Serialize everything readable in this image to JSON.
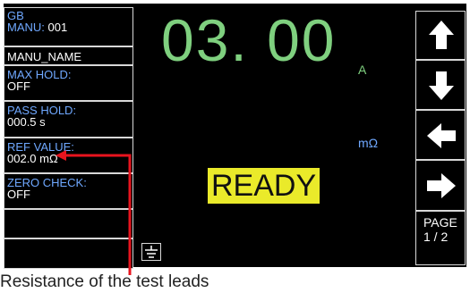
{
  "left_panel": {
    "title": "GB",
    "manu_label": "MANU:",
    "manu_value": "001",
    "manu_name": "MANU_NAME",
    "max_hold_label": "MAX HOLD:",
    "max_hold_value": "OFF",
    "pass_hold_label": "PASS HOLD:",
    "pass_hold_value": "000.5 s",
    "ref_value_label": "REF VALUE:",
    "ref_value_value": "002.0 mΩ",
    "zero_check_label": "ZERO CHECK:",
    "zero_check_value": "OFF"
  },
  "main": {
    "current_reading": "03. 00",
    "current_unit": "A",
    "resistance_unit": "mΩ",
    "status": "READY",
    "ground_icon": "ground-icon"
  },
  "right_panel": {
    "buttons": [
      "arrow-up-icon",
      "arrow-down-icon",
      "arrow-left-icon",
      "arrow-right-icon"
    ],
    "page_label": "PAGE",
    "page_number": "1 / 2"
  },
  "annotation": {
    "text": "Resistance of the test leads",
    "color": "#e8141e"
  },
  "colors": {
    "reading": "#7fd07f",
    "label": "#6fa8ff",
    "status_bg": "#eaea2a",
    "screen_bg": "#000000"
  }
}
